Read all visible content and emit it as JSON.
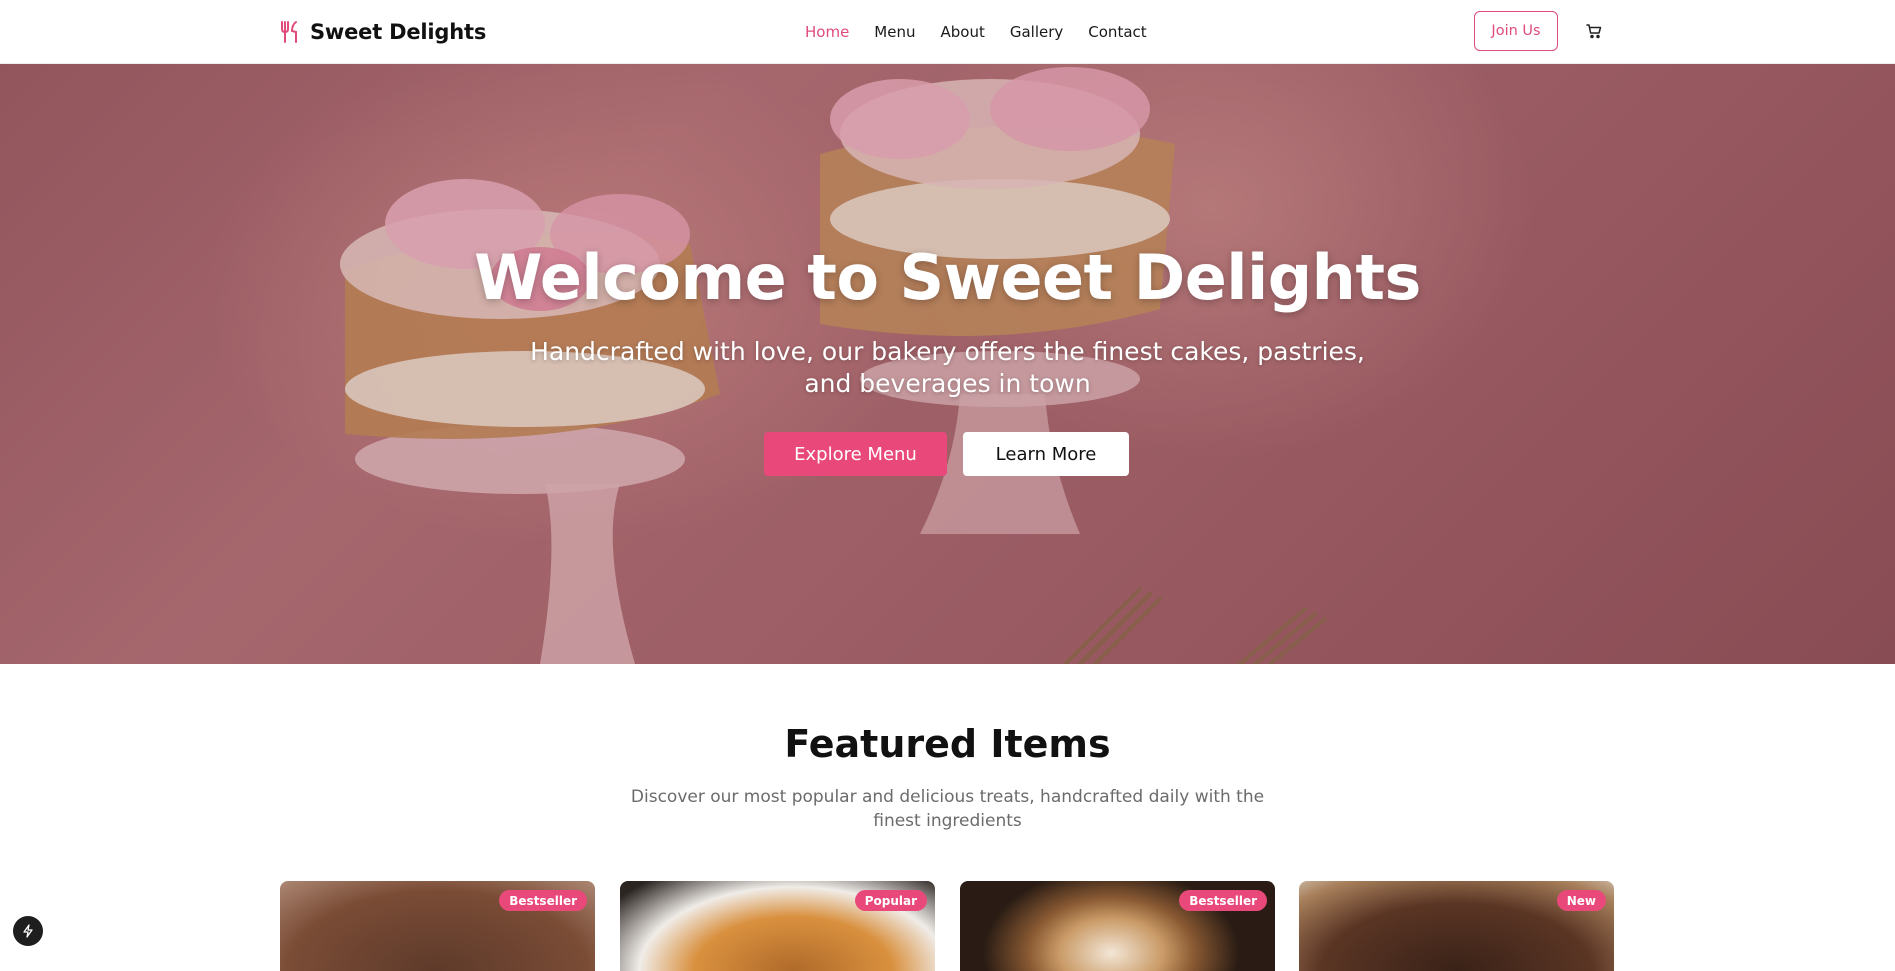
{
  "brand": {
    "name": "Sweet Delights",
    "icon": "fork-knife-icon",
    "accent": "#e04b7a"
  },
  "nav": {
    "links": [
      {
        "label": "Home",
        "active": true
      },
      {
        "label": "Menu",
        "active": false
      },
      {
        "label": "About",
        "active": false
      },
      {
        "label": "Gallery",
        "active": false
      },
      {
        "label": "Contact",
        "active": false
      }
    ],
    "join_label": "Join Us",
    "cart_icon": "shopping-cart-icon"
  },
  "hero": {
    "title": "Welcome to Sweet Delights",
    "subtitle": "Handcrafted with love, our bakery offers the finest cakes, pastries, and beverages in town",
    "primary_button": "Explore Menu",
    "secondary_button": "Learn More",
    "primary_color": "#e9497a"
  },
  "featured": {
    "title": "Featured Items",
    "subtitle": "Discover our most popular and delicious treats, handcrafted daily with the finest ingredients",
    "cards": [
      {
        "badge": "Bestseller"
      },
      {
        "badge": "Popular"
      },
      {
        "badge": "Bestseller"
      },
      {
        "badge": "New"
      }
    ]
  },
  "floating": {
    "icon": "lightning-icon"
  }
}
